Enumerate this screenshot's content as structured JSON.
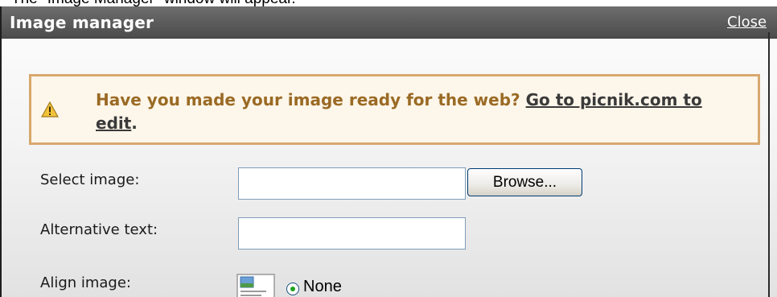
{
  "caption": "The \"Image Manager\" window will appear.",
  "window": {
    "title": "Image manager",
    "close_label": "Close"
  },
  "notice": {
    "icon": "warning-icon",
    "message": "Have you made your image ready for the web?",
    "link_text": "Go to picnik.com to edit",
    "suffix": "."
  },
  "form": {
    "select_image": {
      "label": "Select image:",
      "value": "",
      "browse_label": "Browse..."
    },
    "alt_text": {
      "label": "Alternative text:",
      "value": ""
    },
    "align": {
      "label": "Align image:",
      "icon": "align-none-image-icon",
      "options": [
        "None"
      ],
      "selected": "None"
    }
  }
}
